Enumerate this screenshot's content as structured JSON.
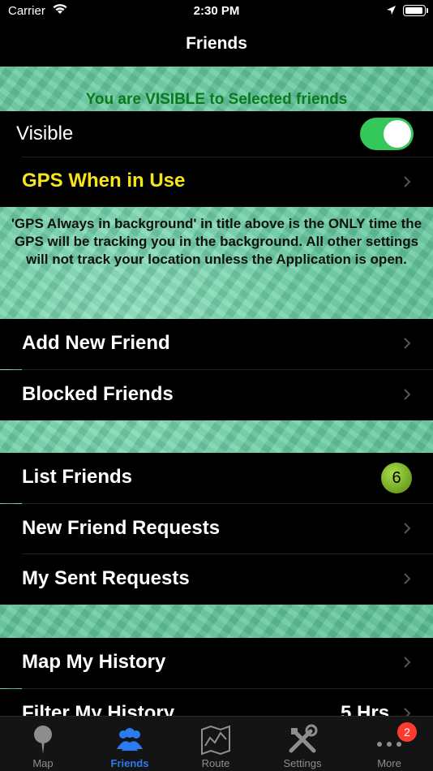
{
  "status_bar": {
    "carrier": "Carrier",
    "time": "2:30 PM"
  },
  "nav": {
    "title": "Friends"
  },
  "visibility": {
    "banner": "You are VISIBLE to Selected friends",
    "visible_label": "Visible",
    "visible_on": true
  },
  "gps": {
    "mode_label": "GPS When in Use",
    "note": "'GPS Always in background' in title above is the ONLY time the GPS will be tracking you in the background.  All other settings will not track your location unless the Application is open."
  },
  "friends_section": {
    "add_new": "Add New Friend",
    "blocked": "Blocked Friends"
  },
  "list_section": {
    "list_friends": "List Friends",
    "list_count": "6",
    "new_requests": "New Friend Requests",
    "sent_requests": "My Sent Requests"
  },
  "history_section": {
    "map_history": "Map My History",
    "filter_history": "Filter My History",
    "filter_value": "5 Hrs"
  },
  "tabs": [
    {
      "label": "Map",
      "icon": "map-pin-icon",
      "active": false
    },
    {
      "label": "Friends",
      "icon": "people-icon",
      "active": true
    },
    {
      "label": "Route",
      "icon": "route-map-icon",
      "active": false
    },
    {
      "label": "Settings",
      "icon": "tools-icon",
      "active": false
    },
    {
      "label": "More",
      "icon": "ellipsis-icon",
      "active": false
    }
  ],
  "more_badge": "2",
  "colors": {
    "accent": "#2a7bf0",
    "toggle_on": "#34c759",
    "gps_label": "#f5e51b",
    "banner_text": "#0b7a1e",
    "badge_red": "#ff3b30"
  }
}
